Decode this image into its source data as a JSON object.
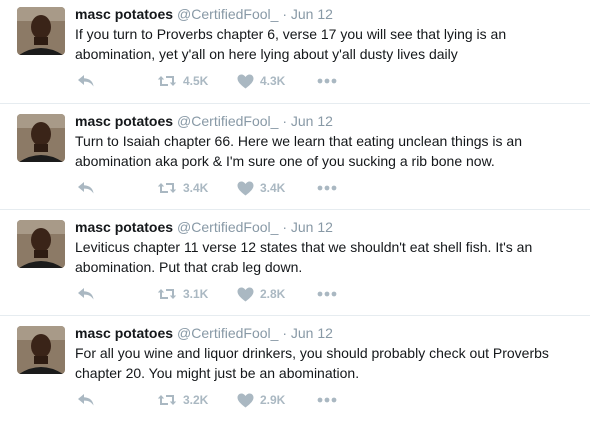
{
  "tweets": [
    {
      "name": "masc potatoes",
      "handle": "@CertifiedFool_",
      "separator": "·",
      "time": "Jun 12",
      "text": "If you turn to Proverbs chapter 6, verse 17 you will see that lying is an\nabomination, yet y'all on here lying about y'all dusty lives daily",
      "retweets": "4.5K",
      "likes": "4.3K"
    },
    {
      "name": "masc potatoes",
      "handle": "@CertifiedFool_",
      "separator": "·",
      "time": "Jun 12",
      "text": "Turn to Isaiah chapter 66. Here we learn that eating unclean things is an\nabomination aka pork & I'm sure one of you sucking a rib bone now.",
      "retweets": "3.4K",
      "likes": "3.4K"
    },
    {
      "name": "masc potatoes",
      "handle": "@CertifiedFool_",
      "separator": "·",
      "time": "Jun 12",
      "text": "Leviticus chapter 11 verse 12 states that we shouldn't eat shell fish. It's an\nabomination. Put that crab leg down.",
      "retweets": "3.1K",
      "likes": "2.8K"
    },
    {
      "name": "masc potatoes",
      "handle": "@CertifiedFool_",
      "separator": "·",
      "time": "Jun 12",
      "text": "For all you wine and liquor drinkers, you should probably check out Proverbs\nchapter 20. You might just be an abomination.",
      "retweets": "3.2K",
      "likes": "2.9K"
    }
  ],
  "icons": {
    "reply": "reply-icon",
    "retweet": "retweet-icon",
    "like": "heart-icon",
    "more": "more-dots-icon"
  },
  "colors": {
    "text": "#14171a",
    "muted": "#8899a6",
    "action": "#aab8c2",
    "divider": "#e6ecf0"
  }
}
